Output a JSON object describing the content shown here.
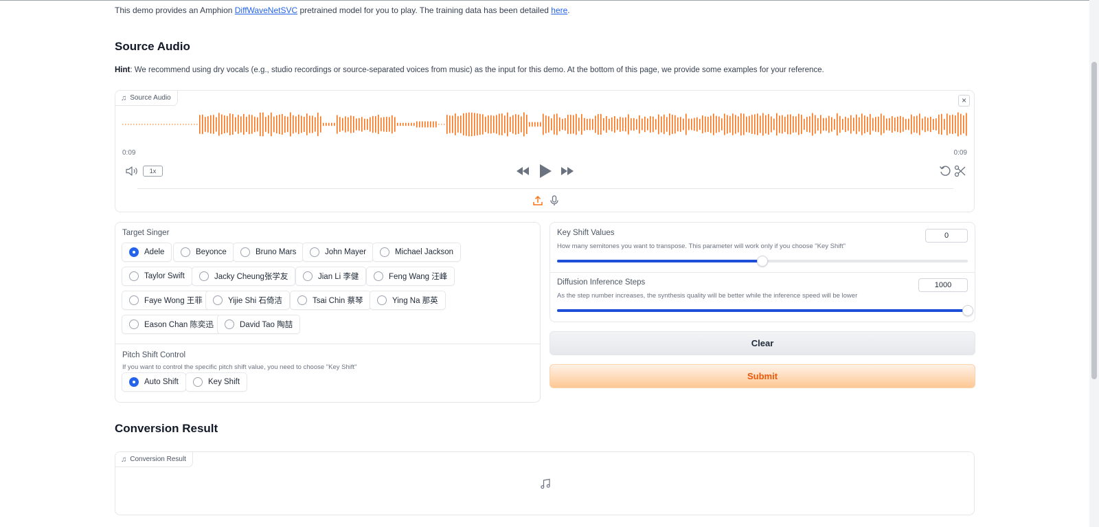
{
  "intro": {
    "prefix": "This demo provides an Amphion ",
    "model_link": "DiffWaveNetSVC",
    "middle": " pretrained model for you to play. The training data has been detailed ",
    "here_link": "here",
    "suffix": "."
  },
  "source": {
    "heading": "Source Audio",
    "hint_bold": "Hint",
    "hint_text": ": We recommend using dry vocals (e.g., studio recordings or source-separated voices from music) as the input for this demo. At the bottom of this page, we provide some examples for your reference.",
    "player": {
      "label": "Source Audio",
      "time_current": "0:09",
      "time_total": "0:09",
      "playback_rate": "1x",
      "close_glyph": "×",
      "waveform_color": "#f97316"
    }
  },
  "target_singer": {
    "label": "Target Singer",
    "selected": "Adele",
    "options": [
      "Adele",
      "Beyonce",
      "Bruno Mars",
      "John Mayer",
      "Michael Jackson",
      "Taylor Swift",
      "Jacky Cheung张学友",
      "Jian Li 李健",
      "Feng Wang 汪峰",
      "Faye Wong 王菲",
      "Yijie Shi 石倚洁",
      "Tsai Chin 蔡琴",
      "Ying Na 那英",
      "Eason Chan 陈奕迅",
      "David Tao 陶喆"
    ]
  },
  "pitch_shift": {
    "label": "Pitch Shift Control",
    "info": "If you want to control the specific pitch shift value, you need to choose \"Key Shift\"",
    "selected": "Auto Shift",
    "options": [
      "Auto Shift",
      "Key Shift"
    ]
  },
  "key_shift": {
    "label": "Key Shift Values",
    "info": "How many semitones you want to transpose. This parameter will work only if you choose \"Key Shift\"",
    "value": "0",
    "slider_fraction": 0.5
  },
  "diffusion": {
    "label": "Diffusion Inference Steps",
    "info": "As the step number increases, the synthesis quality will be better while the inference speed will be lower",
    "value": "1000",
    "slider_fraction": 1.0
  },
  "buttons": {
    "clear": "Clear",
    "submit": "Submit"
  },
  "result": {
    "heading": "Conversion Result",
    "label": "Conversion Result"
  },
  "colors": {
    "accent_blue": "#2563eb",
    "accent_orange": "#ea580c",
    "link": "#2563eb"
  }
}
